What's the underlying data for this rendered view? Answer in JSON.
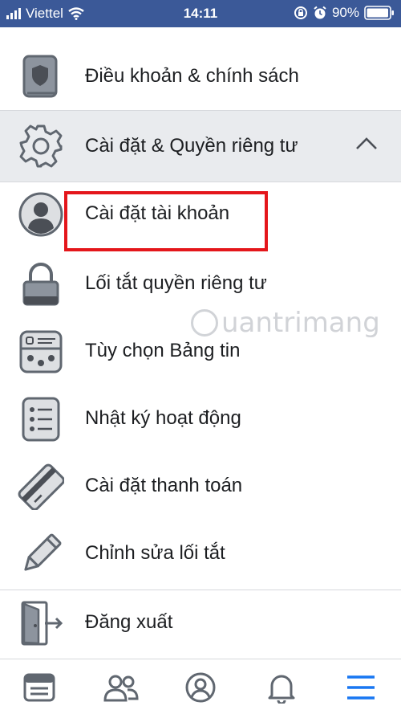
{
  "status_bar": {
    "carrier": "Viettel",
    "time": "14:11",
    "battery": "90%"
  },
  "menu": {
    "items": [
      {
        "label": "Điều khoản & chính sách",
        "icon": "policy-book-icon"
      },
      {
        "label": "Cài đặt & Quyền riêng tư",
        "icon": "gear-icon",
        "expanded": true
      },
      {
        "label": "Cài đặt tài khoản",
        "icon": "account-avatar-icon"
      },
      {
        "label": "Lối tắt quyền riêng tư",
        "icon": "lock-icon"
      },
      {
        "label": "Tùy chọn Bảng tin",
        "icon": "news-feed-preferences-icon"
      },
      {
        "label": "Nhật ký hoạt động",
        "icon": "activity-log-icon"
      },
      {
        "label": "Cài đặt thanh toán",
        "icon": "credit-card-icon"
      },
      {
        "label": "Chỉnh sửa lối tắt",
        "icon": "pencil-icon"
      },
      {
        "label": "Đăng xuất",
        "icon": "logout-door-icon"
      }
    ]
  },
  "watermark": {
    "text": "uantrimang"
  },
  "tab_bar": {
    "tabs": [
      {
        "icon": "news-feed-icon",
        "active": false
      },
      {
        "icon": "friends-icon",
        "active": false
      },
      {
        "icon": "profile-icon",
        "active": false
      },
      {
        "icon": "notifications-bell-icon",
        "active": false
      },
      {
        "icon": "menu-hamburger-icon",
        "active": true
      }
    ]
  },
  "colors": {
    "status_bar": "#3b5998",
    "section_bg": "#e9ebee",
    "icon_gray": "#606770",
    "icon_fill": "#8d949e",
    "highlight": "#e4161b",
    "active_tab": "#1877f2"
  }
}
